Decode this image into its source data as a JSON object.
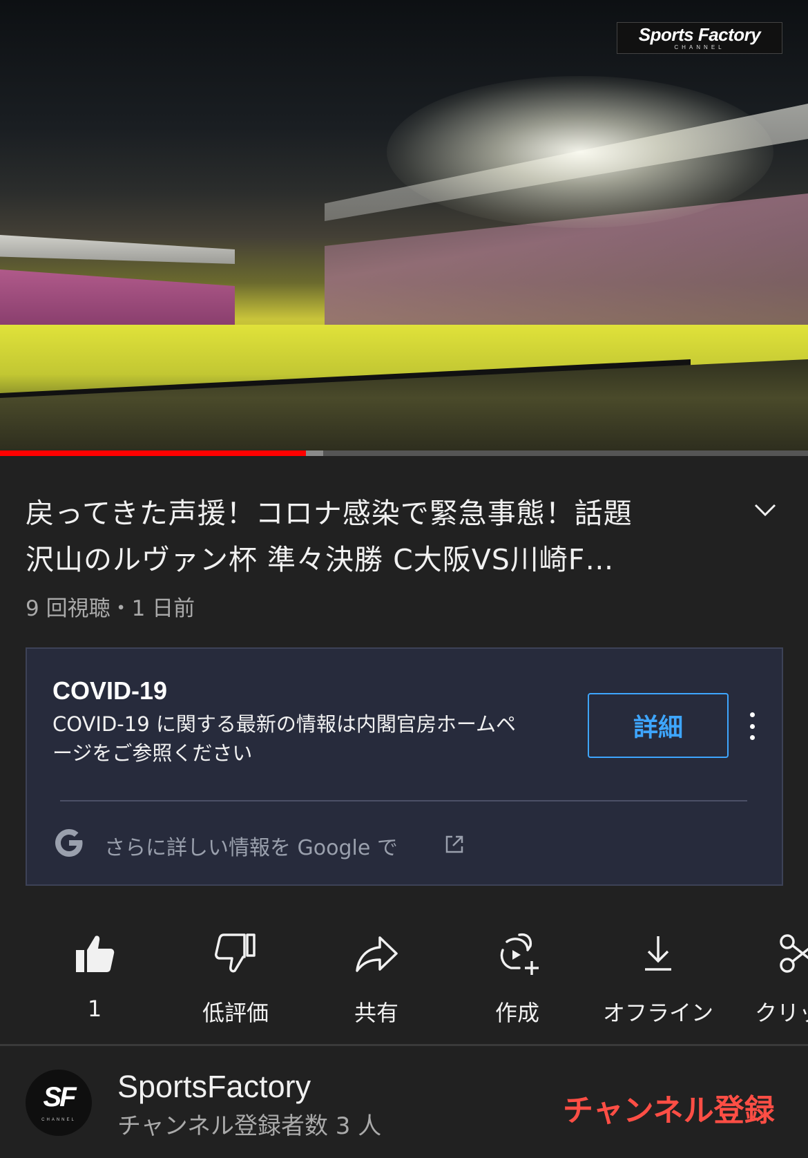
{
  "video": {
    "overlay_logo": "Sports Factory",
    "overlay_logo_sub": "CHANNEL",
    "progress": 0.379
  },
  "title": {
    "line1": "戻ってきた声援！コロナ感染で緊急事態！話題",
    "line2": "沢山のルヴァン杯 準々決勝 C大阪VS川崎F…",
    "meta": "9 回視聴・1 日前"
  },
  "covid_card": {
    "heading": "COVID-19",
    "body": "COVID-19 に関する最新の情報は内閣官房ホームページをご参照ください",
    "detail_button": "詳細",
    "more_link": "さらに詳しい情報を Google で"
  },
  "actions": [
    {
      "label": "1",
      "icon": "thumbs-up-icon"
    },
    {
      "label": "低評価",
      "icon": "thumbs-down-icon"
    },
    {
      "label": "共有",
      "icon": "share-icon"
    },
    {
      "label": "作成",
      "icon": "create-icon"
    },
    {
      "label": "オフライン",
      "icon": "download-icon"
    },
    {
      "label": "クリップ",
      "icon": "scissors-icon"
    }
  ],
  "channel": {
    "avatar_text": "SF",
    "avatar_sub": "CHANNEL",
    "name": "SportsFactory",
    "subscribers": "チャンネル登録者数 3 人",
    "subscribe_button": "チャンネル登録"
  },
  "colors": {
    "background": "#212121",
    "progress_red": "#ff0000",
    "link_blue": "#3ea6ff",
    "subscribe_red": "#ff4e45",
    "card_bg": "#272b3c"
  }
}
